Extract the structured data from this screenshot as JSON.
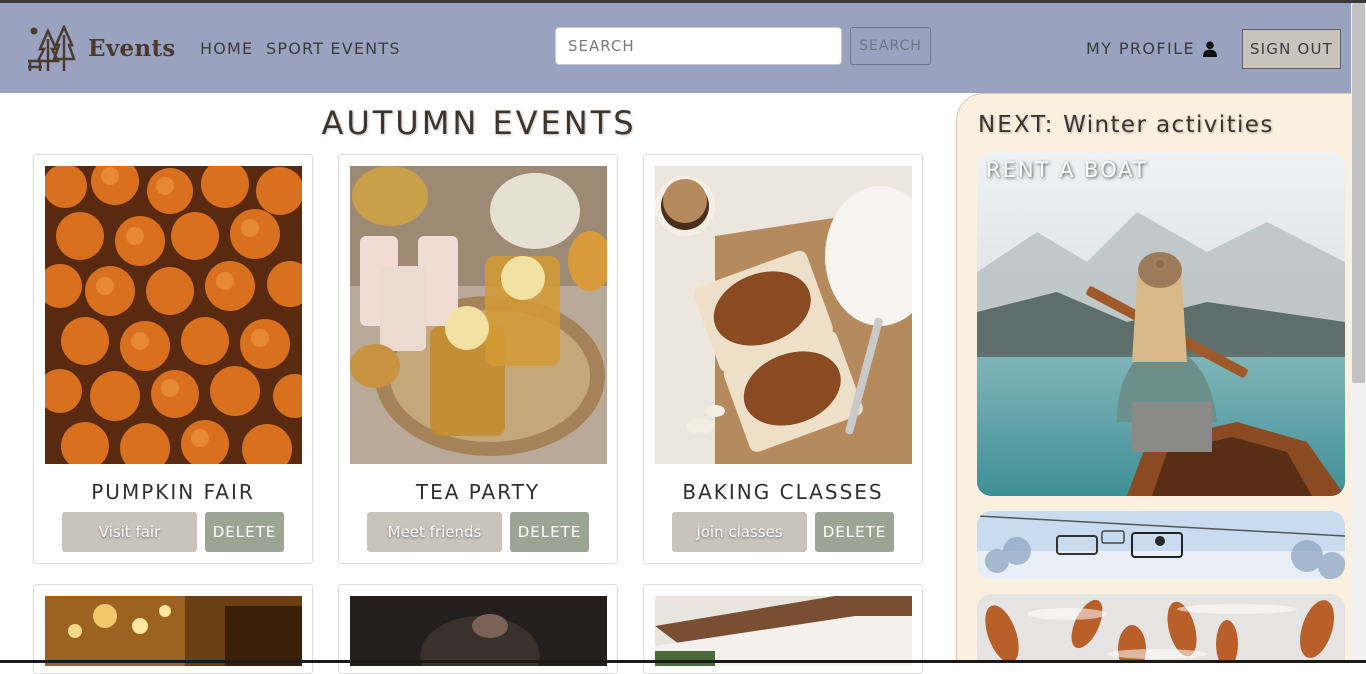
{
  "navbar": {
    "brand": "Events",
    "links": [
      "HOME",
      "SPORT EVENTS"
    ],
    "search_placeholder": "SEARCH",
    "search_button": "SEARCH",
    "profile_label": "MY PROFILE",
    "signout_label": "SIGN OUT"
  },
  "main": {
    "title": "AUTUMN EVENTS",
    "cards": [
      {
        "title": "PUMPKIN FAIR",
        "action": "Visit fair",
        "delete": "DELETE"
      },
      {
        "title": "TEA PARTY",
        "action": "Meet friends",
        "delete": "DELETE"
      },
      {
        "title": "BAKING CLASSES",
        "action": "Join classes",
        "delete": "DELETE"
      }
    ]
  },
  "sidebar": {
    "next_label": "NEXT:",
    "next_value": "Winter activities",
    "featured_label": "RENT A BOAT"
  },
  "colors": {
    "navbar": "#99a3bf",
    "action_button": "#c9c3bc",
    "delete_button": "#9aa593",
    "sidebar": "#faf0e0"
  }
}
